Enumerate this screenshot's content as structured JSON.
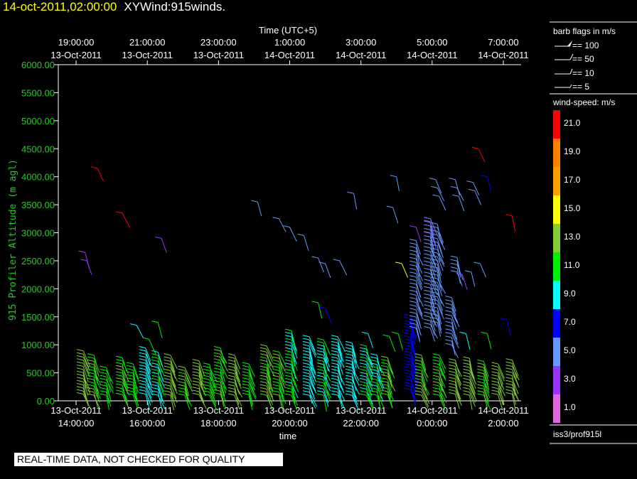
{
  "header": {
    "date": "14-oct-2011,02:00:00",
    "name": "XYWind:915winds."
  },
  "notice": "REAL-TIME DATA, NOT CHECKED FOR QUALITY",
  "colors": {
    "ylabel": "#22cc22",
    "title_date": "#ffff00",
    "scale": [
      "#ff0000",
      "#ff7f00",
      "#ff9f00",
      "#ffff00",
      "#7fcc33",
      "#00ee00",
      "#00ffff",
      "#0000ff",
      "#6699ff",
      "#9933ff",
      "#e066e0"
    ]
  },
  "legend": {
    "barb_title": "barb flags in m/s",
    "barbs": [
      "== 100",
      "== 50",
      "== 10",
      "== 5"
    ],
    "speed_title": "wind-speed: m/s",
    "speed_labels": [
      "21.0",
      "19.0",
      "17.0",
      "15.0",
      "13.0",
      "11.0",
      "9.0",
      "7.0",
      "5.0",
      "3.0",
      "1.0"
    ],
    "source": "iss3/prof915l"
  },
  "chart_data": {
    "type": "scatter",
    "xlabel": "time",
    "top_axis_label": "Time (UTC+5)",
    "ylabel": "915 Profiler Altitude (m agl)",
    "ylim": [
      0,
      6000
    ],
    "yticks": [
      "0.00",
      "500.00",
      "1000.00",
      "1500.00",
      "2000.00",
      "2500.00",
      "3000.00",
      "3500.00",
      "4000.00",
      "4500.00",
      "5000.00",
      "5500.00",
      "6000.00"
    ],
    "xlim_hours": [
      13.5,
      26.5
    ],
    "bottom_ticks": [
      {
        "h": 14,
        "date": "13-Oct-2011",
        "time": "14:00:00"
      },
      {
        "h": 16,
        "date": "13-Oct-2011",
        "time": "16:00:00"
      },
      {
        "h": 18,
        "date": "13-Oct-2011",
        "time": "18:00:00"
      },
      {
        "h": 20,
        "date": "13-Oct-2011",
        "time": "20:00:00"
      },
      {
        "h": 22,
        "date": "13-Oct-2011",
        "time": "22:00:00"
      },
      {
        "h": 24,
        "date": "14-Oct-2011",
        "time": "0:00:00"
      },
      {
        "h": 26,
        "date": "14-Oct-2011",
        "time": "2:00:00"
      }
    ],
    "top_ticks": [
      {
        "h": 14,
        "time": "19:00:00",
        "date": "13-Oct-2011"
      },
      {
        "h": 16,
        "time": "21:00:00",
        "date": "13-Oct-2011"
      },
      {
        "h": 18,
        "time": "23:00:00",
        "date": "13-Oct-2011"
      },
      {
        "h": 20,
        "time": "1:00:00",
        "date": "14-Oct-2011"
      },
      {
        "h": 22,
        "time": "3:00:00",
        "date": "14-Oct-2011"
      },
      {
        "h": 24,
        "time": "5:00:00",
        "date": "14-Oct-2011"
      },
      {
        "h": 26,
        "time": "7:00:00",
        "date": "14-Oct-2011"
      }
    ],
    "profiles": [
      {
        "h": 14.2,
        "z0": 120,
        "z1": 940,
        "s": 12.5
      },
      {
        "h": 14.5,
        "z0": 100,
        "z1": 830,
        "s": 12
      },
      {
        "h": 14.85,
        "z0": 100,
        "z1": 640,
        "s": 11.5
      },
      {
        "h": 15.3,
        "z0": 110,
        "z1": 780,
        "s": 12
      },
      {
        "h": 15.6,
        "z0": 110,
        "z1": 670,
        "s": 11.5
      },
      {
        "h": 15.95,
        "z0": 120,
        "z1": 950,
        "s": 9.5
      },
      {
        "h": 16.3,
        "z0": 100,
        "z1": 870,
        "s": 10
      },
      {
        "h": 16.65,
        "z0": 100,
        "z1": 860,
        "s": 12.5
      },
      {
        "h": 17.05,
        "z0": 100,
        "z1": 620,
        "s": 12
      },
      {
        "h": 17.45,
        "z0": 110,
        "z1": 720,
        "s": 12.5
      },
      {
        "h": 17.75,
        "z0": 100,
        "z1": 660,
        "s": 11.5
      },
      {
        "h": 18.05,
        "z0": 120,
        "z1": 980,
        "s": 12
      },
      {
        "h": 18.45,
        "z0": 100,
        "z1": 820,
        "s": 12.5
      },
      {
        "h": 18.85,
        "z0": 110,
        "z1": 700,
        "s": 11.5
      },
      {
        "h": 19.35,
        "z0": 100,
        "z1": 1000,
        "s": 12
      },
      {
        "h": 19.7,
        "z0": 100,
        "z1": 920,
        "s": 12
      },
      {
        "h": 20.05,
        "z0": 100,
        "z1": 1300,
        "s": 10
      },
      {
        "h": 20.55,
        "z0": 100,
        "z1": 1180,
        "s": 9.5
      },
      {
        "h": 20.95,
        "z0": 100,
        "z1": 1120,
        "s": 10
      },
      {
        "h": 21.35,
        "z0": 100,
        "z1": 1150,
        "s": 9.5
      },
      {
        "h": 21.75,
        "z0": 100,
        "z1": 1060,
        "s": 9.5
      },
      {
        "h": 22.15,
        "z0": 100,
        "z1": 980,
        "s": 10
      },
      {
        "h": 22.45,
        "z0": 100,
        "z1": 860,
        "s": 10
      },
      {
        "h": 22.75,
        "z0": 110,
        "z1": 780,
        "s": 12
      },
      {
        "h": 23.4,
        "z0": 200,
        "z1": 1550,
        "s": 7.5
      },
      {
        "h": 23.7,
        "z0": 100,
        "z1": 840,
        "s": 12
      },
      {
        "h": 24.2,
        "z0": 100,
        "z1": 820,
        "s": 12
      },
      {
        "h": 24.65,
        "z0": 120,
        "z1": 770,
        "s": 12.5
      },
      {
        "h": 25.05,
        "z0": 100,
        "z1": 760,
        "s": 12.5
      },
      {
        "h": 25.45,
        "z0": 100,
        "z1": 720,
        "s": 12
      },
      {
        "h": 25.85,
        "z0": 110,
        "z1": 700,
        "s": 12.5
      },
      {
        "h": 26.25,
        "z0": 120,
        "z1": 760,
        "s": 13
      }
    ],
    "scattered": [
      {
        "h": 14.25,
        "z": 2650,
        "s": 4
      },
      {
        "h": 14.3,
        "z": 2500,
        "s": 4
      },
      {
        "h": 14.6,
        "z": 4150,
        "s": 20.5
      },
      {
        "h": 15.3,
        "z": 3350,
        "s": 21
      },
      {
        "h": 16.4,
        "z": 2900,
        "s": 4
      },
      {
        "h": 15.7,
        "z": 1350,
        "s": 10
      },
      {
        "h": 16.3,
        "z": 1400,
        "s": 12
      },
      {
        "h": 16.05,
        "z": 1100,
        "s": 12
      },
      {
        "h": 19.1,
        "z": 3550,
        "s": 5
      },
      {
        "h": 19.7,
        "z": 3250,
        "s": 5
      },
      {
        "h": 20.0,
        "z": 3100,
        "s": 5
      },
      {
        "h": 20.4,
        "z": 2950,
        "s": 5
      },
      {
        "h": 20.8,
        "z": 2550,
        "s": 5
      },
      {
        "h": 21.0,
        "z": 2450,
        "s": 5
      },
      {
        "h": 21.4,
        "z": 2500,
        "s": 5
      },
      {
        "h": 21.8,
        "z": 3700,
        "s": 5
      },
      {
        "h": 22.2,
        "z": 1200,
        "s": 10
      },
      {
        "h": 22.8,
        "z": 1150,
        "s": 12
      },
      {
        "h": 23.15,
        "z": 2450,
        "s": 15
      },
      {
        "h": 23.05,
        "z": 1200,
        "s": 12
      },
      {
        "h": 23.0,
        "z": 4000,
        "s": 5
      },
      {
        "h": 22.9,
        "z": 3450,
        "s": 5
      },
      {
        "h": 24.1,
        "z": 3950,
        "s": 5
      },
      {
        "h": 24.15,
        "z": 3800,
        "s": 5
      },
      {
        "h": 24.2,
        "z": 3650,
        "s": 5
      },
      {
        "h": 24.65,
        "z": 3950,
        "s": 5
      },
      {
        "h": 24.7,
        "z": 3800,
        "s": 5
      },
      {
        "h": 24.75,
        "z": 3650,
        "s": 5
      },
      {
        "h": 25.15,
        "z": 3900,
        "s": 5
      },
      {
        "h": 25.2,
        "z": 3750,
        "s": 5
      },
      {
        "h": 25.55,
        "z": 4000,
        "s": 7
      },
      {
        "h": 25.3,
        "z": 4500,
        "s": 21
      },
      {
        "h": 26.25,
        "z": 3300,
        "s": 21
      },
      {
        "h": 25.35,
        "z": 2450,
        "s": 5
      },
      {
        "h": 25.1,
        "z": 2300,
        "s": 5
      },
      {
        "h": 24.85,
        "z": 2250,
        "s": 3
      },
      {
        "h": 23.55,
        "z": 3100,
        "s": 3
      },
      {
        "h": 23.95,
        "z": 3200,
        "s": 3
      },
      {
        "h": 23.95,
        "z": 3000,
        "s": 3
      },
      {
        "h": 25.55,
        "z": 1200,
        "s": 12
      },
      {
        "h": 26.1,
        "z": 1450,
        "s": 7
      },
      {
        "h": 24.95,
        "z": 1200,
        "s": 10
      },
      {
        "h": 21.0,
        "z": 1650,
        "s": 7
      },
      {
        "h": 20.8,
        "z": 1750,
        "s": 12
      }
    ],
    "dense_columns": [
      {
        "h": 23.55,
        "z0": 1300,
        "z1": 2900,
        "s": 5
      },
      {
        "h": 23.95,
        "z0": 1300,
        "z1": 3300,
        "s": 5
      },
      {
        "h": 24.15,
        "z0": 1400,
        "z1": 3200,
        "s": 5
      },
      {
        "h": 24.55,
        "z0": 1000,
        "z1": 1900,
        "s": 5
      },
      {
        "h": 24.7,
        "z0": 2300,
        "z1": 2600,
        "s": 5
      }
    ]
  }
}
